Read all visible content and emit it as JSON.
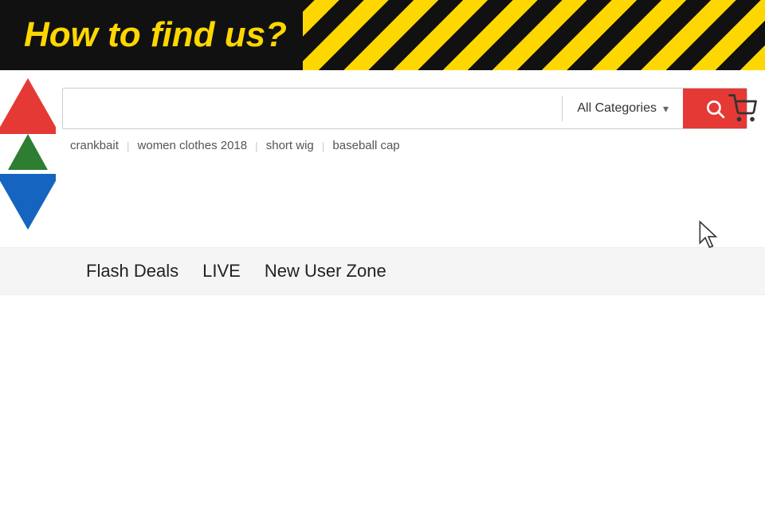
{
  "banner": {
    "title": "How to find us?",
    "background_color": "#111111",
    "title_color": "#FFD700"
  },
  "search": {
    "input_placeholder": "",
    "input_value": "",
    "categories_label": "All Categories",
    "button_aria": "Search"
  },
  "suggestions": [
    {
      "text": "crankbait"
    },
    {
      "text": "women clothes 2018"
    },
    {
      "text": "short wig"
    },
    {
      "text": "baseball cap"
    }
  ],
  "navigation": {
    "items": [
      {
        "label": "Flash Deals"
      },
      {
        "label": "LIVE"
      },
      {
        "label": "New User Zone"
      }
    ]
  },
  "cart": {
    "icon": "🛒"
  },
  "cursor": {
    "symbol": "↖"
  }
}
